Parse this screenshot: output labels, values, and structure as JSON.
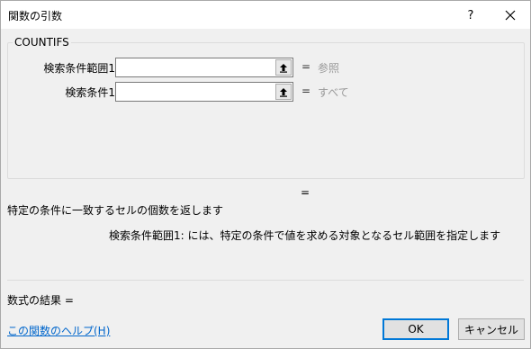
{
  "window": {
    "title": "関数の引数",
    "help_glyph": "?",
    "close_icon": "close-icon"
  },
  "function": {
    "name": "COUNTIFS",
    "args": [
      {
        "label": "検索条件範囲1",
        "value": "",
        "result_eq": "=",
        "result": "参照"
      },
      {
        "label": "検索条件1",
        "value": "",
        "result_eq": "=",
        "result": "すべて"
      }
    ],
    "result_eq": "="
  },
  "description": "特定の条件に一致するセルの個数を返します",
  "arg_description": "検索条件範囲1:  には、特定の条件で値を求める対象となるセル範囲を指定します",
  "formula_result": "数式の結果 =",
  "help_link": "この関数のヘルプ(H)",
  "buttons": {
    "ok": "OK",
    "cancel": "キャンセル"
  },
  "colors": {
    "accent": "#0078d7",
    "link": "#0066cc",
    "muted": "#9a9a9a"
  }
}
